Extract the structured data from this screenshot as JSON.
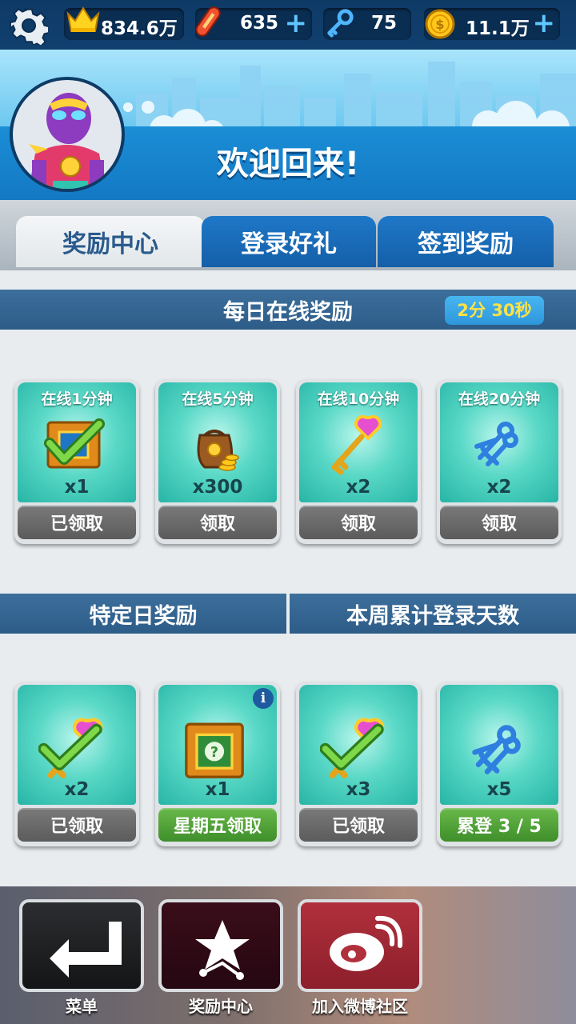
{
  "topbar": {
    "settings_icon": "gear-icon",
    "crown_value": "834.6万",
    "crown_icon": "crown-icon",
    "board_value": "635",
    "board_icon": "hoverboard-icon",
    "key_value": "75",
    "key_icon": "key-icon",
    "coin_value": "11.1万",
    "coin_icon": "coin-icon",
    "plus": "+"
  },
  "header": {
    "welcome": "欢迎回来!"
  },
  "tabs": [
    {
      "label": "奖励中心"
    },
    {
      "label": "登录好礼"
    },
    {
      "label": "签到奖励"
    }
  ],
  "online": {
    "title": "每日在线奖励",
    "timer": "2分 30秒",
    "cards": [
      {
        "title": "在线1分钟",
        "qty": "x1",
        "button": "已领取",
        "icon": "mystery-box-claimed-icon"
      },
      {
        "title": "在线5分钟",
        "qty": "x300",
        "button": "领取",
        "icon": "coin-bag-icon"
      },
      {
        "title": "在线10分钟",
        "qty": "x2",
        "button": "领取",
        "icon": "heart-key-icon"
      },
      {
        "title": "在线20分钟",
        "qty": "x2",
        "button": "领取",
        "icon": "key-bundle-icon"
      }
    ]
  },
  "special": {
    "left_title": "特定日奖励",
    "right_title": "本周累计登录天数",
    "info": "i",
    "cards": [
      {
        "qty": "x2",
        "button": "已领取",
        "icon": "heart-key-claimed-icon"
      },
      {
        "qty": "x1",
        "button": "星期五领取",
        "icon": "mystery-box-icon"
      },
      {
        "qty": "x3",
        "button": "已领取",
        "icon": "heart-key-claimed-icon"
      },
      {
        "qty": "x5",
        "button": "累登 3 / 5",
        "icon": "key-bundle-icon"
      }
    ]
  },
  "bottom": {
    "menu_label": "菜单",
    "rewards_label": "奖励中心",
    "weibo_label": "加入微博社区",
    "menu_icon": "return-arrow-icon",
    "rewards_icon": "star-path-icon",
    "weibo_icon": "weibo-icon"
  }
}
